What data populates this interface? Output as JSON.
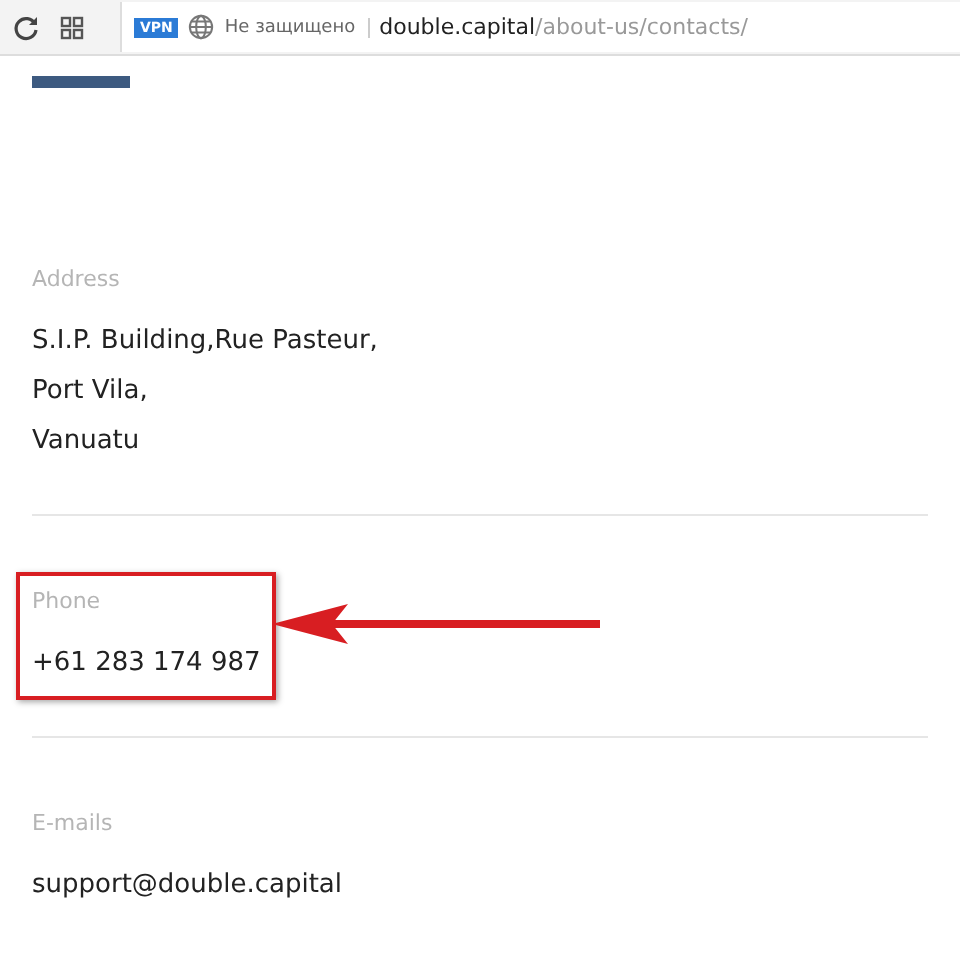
{
  "browser": {
    "vpn_badge": "VPN",
    "security": "Не защищено",
    "url_host": "double.capital",
    "url_path": "/about-us/contacts/"
  },
  "sections": [
    {
      "label": "Address",
      "lines": [
        "S.I.P. Building,Rue Pasteur,",
        "Port Vila,",
        "Vanuatu"
      ],
      "highlighted": false
    },
    {
      "label": "Phone",
      "lines": [
        "+61 283 174 987"
      ],
      "highlighted": true
    },
    {
      "label": "E-mails",
      "lines": [
        "support@double.capital"
      ],
      "highlighted": false
    }
  ]
}
